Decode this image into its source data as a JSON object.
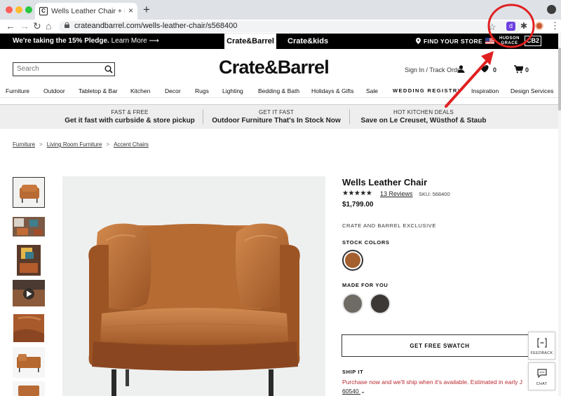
{
  "browser": {
    "tab_title": "Wells Leather Chair + Reviews",
    "tab_close": "×",
    "new_tab": "+",
    "favicon_letter": "C",
    "url": "crateandbarrel.com/wells-leather-chair/s568400",
    "back": "←",
    "forward": "→",
    "reload": "↻",
    "home": "⌂",
    "star": "☆",
    "ext_letter": "d",
    "puzzle": "✱",
    "kebab": "⋮",
    "traffic_colors": [
      "#ff5f57",
      "#febc2e",
      "#28c840"
    ]
  },
  "promo": {
    "text_bold": "We're taking the 15% Pledge.",
    "text_link": "Learn More",
    "arrow": "⟶",
    "brand_tabs": [
      "Crate&Barrel",
      "Crate&kids"
    ],
    "find_store": "FIND YOUR STORE",
    "hudson_grace": [
      "HUDSON",
      "GRACE"
    ],
    "cb2": "CB2"
  },
  "header": {
    "search_placeholder": "Search",
    "logo": "Crate&Barrel",
    "signin": "Sign In / Track Order",
    "favorites_count": "0",
    "cart_count": "0"
  },
  "nav": {
    "items": [
      "Furniture",
      "Outdoor",
      "Tabletop & Bar",
      "Kitchen",
      "Decor",
      "Rugs",
      "Lighting",
      "Bedding & Bath",
      "Holidays & Gifts",
      "Sale"
    ],
    "wedding": "WEDDING REGISTRY",
    "inspiration": "Inspiration",
    "design_services": "Design Services"
  },
  "strip": [
    {
      "small": "FAST & FREE",
      "big": "Get it fast with curbside & store pickup"
    },
    {
      "small": "GET IT FAST",
      "big": "Outdoor Furniture That's In Stock Now"
    },
    {
      "small": "HOT KITCHEN DEALS",
      "big": "Save on Le Creuset, Wüsthof & Staub"
    }
  ],
  "breadcrumb": {
    "items": [
      "Furniture",
      "Living Room Furniture",
      "Accent Chairs"
    ],
    "sep": ">"
  },
  "product": {
    "title": "Wells Leather Chair",
    "stars": "★★★★★",
    "reviews": "13 Reviews",
    "sku": "SKU: 568400",
    "price": "$1,799.00",
    "exclusive": "CRATE AND BARREL EXCLUSIVE",
    "stock_colors_label": "STOCK COLORS",
    "made_for_you_label": "MADE FOR YOU",
    "swatch_button": "GET FREE SWATCH",
    "ship_label": "SHIP IT",
    "ship_message": "Purchase now and we'll ship when it's available. Estimated in early J",
    "zip": "60540",
    "zip_chevron": "⌄",
    "swatch_colors": {
      "stock": "#a4602e",
      "made1": "#6e6a64",
      "made2": "#3b3835"
    },
    "leather_color": "#b86a34"
  },
  "widgets": {
    "feedback": "FEEDBACK",
    "chat": "CHAT"
  },
  "annotation_color": "#e02020"
}
